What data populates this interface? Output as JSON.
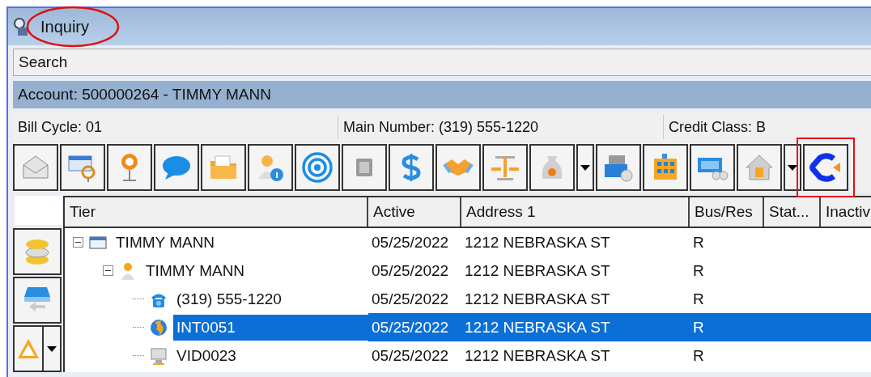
{
  "window": {
    "title": "Inquiry",
    "title_highlighted": true
  },
  "search_bar": {
    "label": "Search"
  },
  "account_bar": {
    "label": "Account: 500000264 - TIMMY MANN"
  },
  "info": [
    "Bill Cycle: 01",
    "Main Number: (319) 555-1220",
    "Credit Class: B"
  ],
  "toolbar": [
    {
      "kind": "button",
      "highlighted": false
    },
    {
      "kind": "button",
      "highlighted": false
    },
    {
      "kind": "button",
      "highlighted": false
    },
    {
      "kind": "button",
      "highlighted": false
    },
    {
      "kind": "button",
      "highlighted": false
    },
    {
      "kind": "button",
      "highlighted": false
    },
    {
      "kind": "button",
      "highlighted": false
    },
    {
      "kind": "button",
      "highlighted": false
    },
    {
      "kind": "button",
      "highlighted": false
    },
    {
      "kind": "button",
      "highlighted": false
    },
    {
      "kind": "button",
      "highlighted": false
    },
    {
      "kind": "button",
      "highlighted": false
    },
    {
      "kind": "dropdown",
      "highlighted": false
    },
    {
      "kind": "button",
      "highlighted": false
    },
    {
      "kind": "button",
      "highlighted": false
    },
    {
      "kind": "button",
      "highlighted": false
    },
    {
      "kind": "button",
      "highlighted": false
    },
    {
      "kind": "dropdown",
      "highlighted": false
    },
    {
      "kind": "button",
      "highlighted": true
    }
  ],
  "side_buttons": [
    {
      "kind": "button"
    },
    {
      "kind": "button"
    },
    {
      "kind": "split"
    }
  ],
  "table": {
    "columns": [
      "Tier",
      "Active",
      "Address 1",
      "Bus/Res",
      "Stat...",
      "Inactiv"
    ],
    "tree": [
      {
        "kind": "account",
        "tier": "TIMMY MANN",
        "active": "05/25/2022",
        "address_1": "1212 NEBRASKA ST",
        "bus_res": "R",
        "selected": false,
        "expanded": true,
        "children": [
          {
            "kind": "person",
            "tier": "TIMMY MANN",
            "active": "05/25/2022",
            "address_1": "1212 NEBRASKA ST",
            "bus_res": "R",
            "selected": false,
            "expanded": true,
            "children": [
              {
                "kind": "phone",
                "tier": "(319) 555-1220",
                "active": "05/25/2022",
                "address_1": "1212 NEBRASKA ST",
                "bus_res": "R",
                "selected": false
              },
              {
                "kind": "internet",
                "tier": "INT0051",
                "active": "05/25/2022",
                "address_1": "1212 NEBRASKA ST",
                "bus_res": "R",
                "selected": true
              },
              {
                "kind": "video",
                "tier": "VID0023",
                "active": "05/25/2022",
                "address_1": "1212 NEBRASKA ST",
                "bus_res": "R",
                "selected": false
              }
            ]
          }
        ]
      }
    ]
  }
}
